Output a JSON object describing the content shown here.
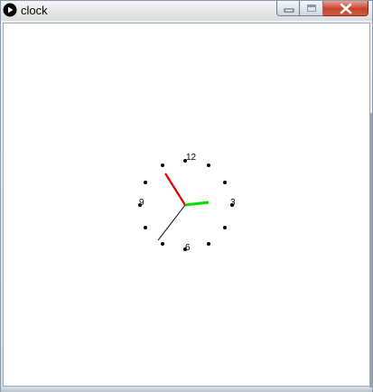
{
  "window": {
    "title": "clock",
    "icon": "play-circle-icon",
    "controls": [
      "minimize-icon",
      "maximize-icon",
      "close-icon"
    ]
  },
  "clock": {
    "numbers": {
      "twelve": "12",
      "three": "3",
      "six": "6",
      "nine": "9"
    },
    "hands": {
      "hour_color": "#00dd00",
      "minute_color": "#dd0000",
      "second_color": "#000000"
    }
  }
}
